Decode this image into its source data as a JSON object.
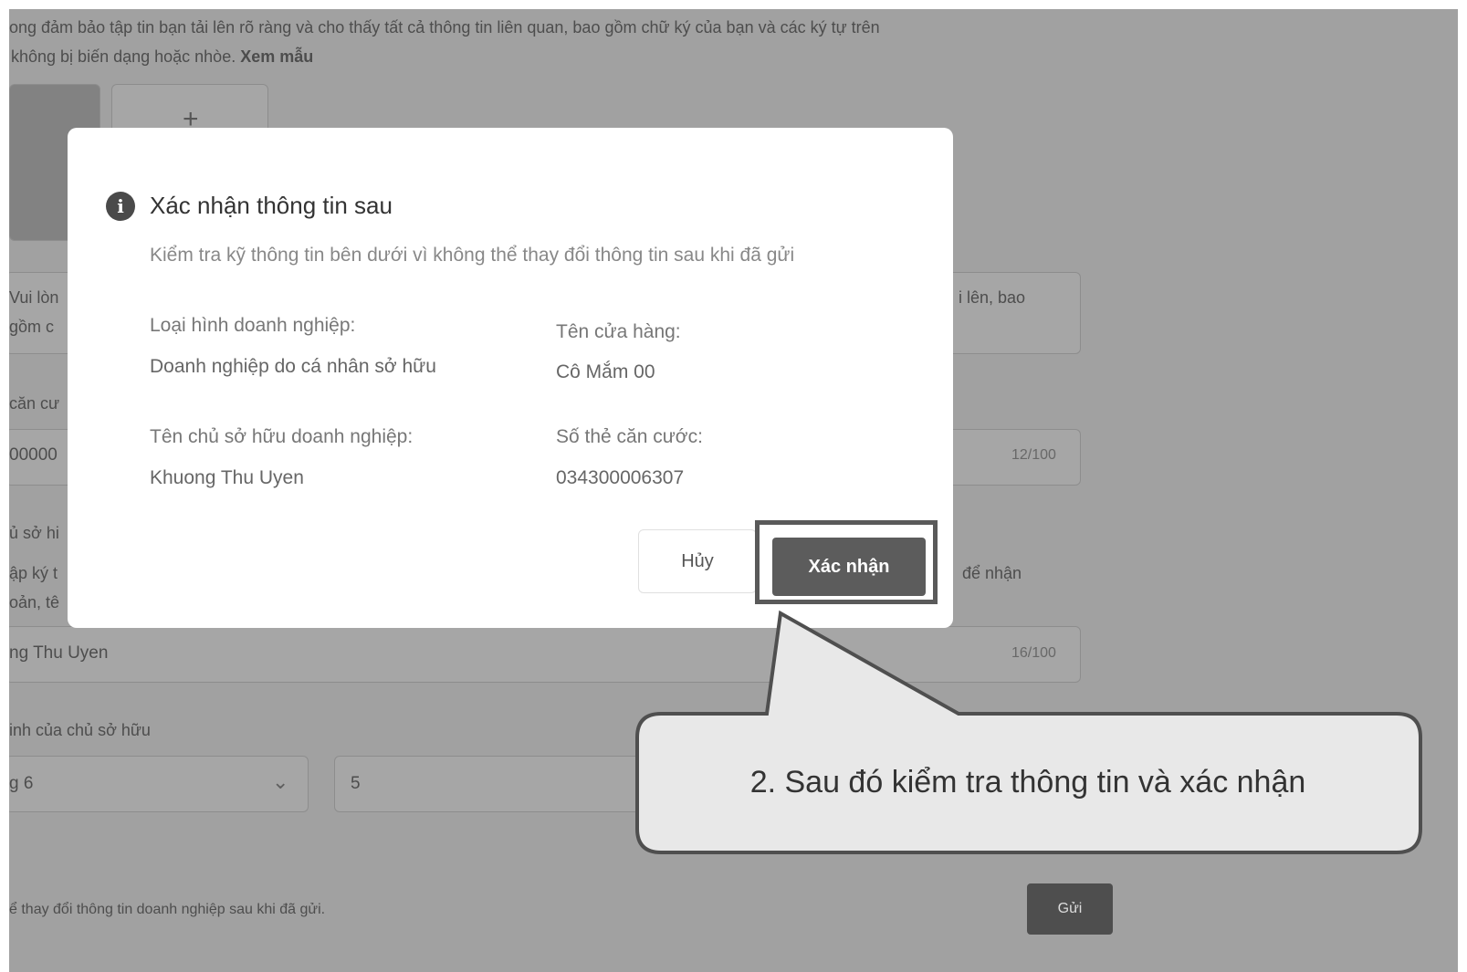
{
  "background": {
    "instruction_line1": "ong đảm bảo tập tin bạn tải lên rõ ràng và cho thấy tất cả thông tin liên quan, bao gồm chữ ký của bạn và các ký tự trên",
    "instruction_line2": "không bị biến dạng hoặc nhòe.",
    "sample_link": "Xem mẫu",
    "upload_plus": "+",
    "left_text_1": "Vui lòn",
    "left_text_2": "gồm c",
    "right_text_1": "i lên, bao",
    "id_label": "căn cư",
    "id_value": "00000",
    "id_counter": "12/100",
    "owner_label": "ủ sở hi",
    "owner_desc_1": "ập ký t",
    "owner_desc_2": "oản, tê",
    "owner_desc_right": "để nhận",
    "owner_name": "ng Thu Uyen",
    "name_counter": "16/100",
    "birth_label": "inh của chủ sở hữu",
    "month_value": "g 6",
    "day_value": "5",
    "footer_note": "ể thay đổi thông tin doanh nghiệp sau khi đã gửi.",
    "send_button": "Gửi"
  },
  "modal": {
    "icon": "info-icon",
    "title": "Xác nhận thông tin sau",
    "subtitle": "Kiểm tra kỹ thông tin bên dưới vì không thể thay đổi thông tin sau khi đã gửi",
    "business_type_label": "Loại hình doanh nghiệp:",
    "business_type_value": "Doanh nghiệp do cá nhân sở hữu",
    "shop_name_label": "Tên cửa hàng:",
    "shop_name_value": "Cô Mắm 00",
    "owner_name_label": "Tên chủ sở hữu doanh nghiệp:",
    "owner_name_value": "Khuong Thu Uyen",
    "id_card_label": "Số thẻ căn cước:",
    "id_card_value": "034300006307",
    "cancel_label": "Hủy",
    "confirm_label": "Xác nhận"
  },
  "callout": {
    "text": "2. Sau đó kiểm tra thông tin và xác nhận"
  }
}
